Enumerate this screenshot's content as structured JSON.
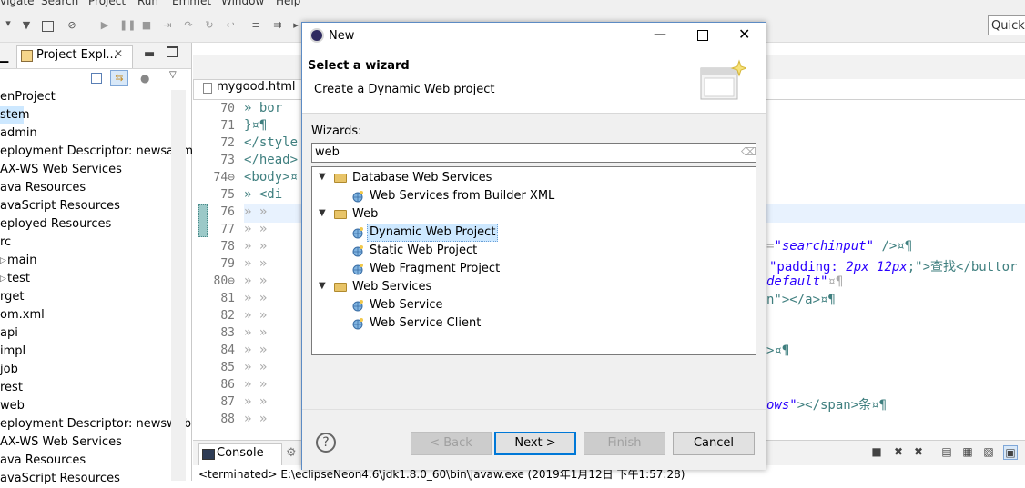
{
  "menubar": {
    "items": [
      "vigate",
      "Search",
      "Project",
      "Run",
      "Emmet",
      "Window",
      "Help"
    ]
  },
  "toolbar": {
    "quick_access_placeholder": "Quick A"
  },
  "project_explorer": {
    "tab_label": "Project Expl...",
    "items": [
      {
        "label": "enProject",
        "indent": 0
      },
      {
        "label": "stem",
        "indent": 0,
        "selected": true
      },
      {
        "label": "admin",
        "indent": 0
      },
      {
        "label": "eployment Descriptor: newsadm",
        "indent": 0
      },
      {
        "label": "AX-WS Web Services",
        "indent": 0
      },
      {
        "label": "ava Resources",
        "indent": 0
      },
      {
        "label": "avaScript Resources",
        "indent": 0
      },
      {
        "label": "eployed Resources",
        "indent": 0
      },
      {
        "label": "rc",
        "indent": 0
      },
      {
        "label": "main",
        "indent": 8
      },
      {
        "label": "test",
        "indent": 8
      },
      {
        "label": "rget",
        "indent": 0
      },
      {
        "label": "om.xml",
        "indent": 0
      },
      {
        "label": "api",
        "indent": 0
      },
      {
        "label": "impl",
        "indent": 0
      },
      {
        "label": "job",
        "indent": 0
      },
      {
        "label": "rest",
        "indent": 0
      },
      {
        "label": "web",
        "indent": 0
      },
      {
        "label": "eployment Descriptor: newsweb",
        "indent": 0
      },
      {
        "label": "AX-WS Web Services",
        "indent": 0
      },
      {
        "label": "ava Resources",
        "indent": 0
      },
      {
        "label": "avaScript Resources",
        "indent": 0
      }
    ]
  },
  "editor": {
    "tab_label": "mygood.html",
    "line_numbers": [
      "70",
      "71",
      "72",
      "73",
      "74⊖",
      "75",
      "76",
      "77",
      "78",
      "79",
      "80⊖",
      "81",
      "82",
      "83",
      "84",
      "85",
      "86",
      "87",
      "88"
    ],
    "code_left": {
      "l70": "» bor",
      "l71": "}¤¶",
      "l72": "</style",
      "l73": "</head>",
      "l74": "<body>¤",
      "l75": "» <di",
      "l76": "» »",
      "l77": "» »",
      "l78": "» »",
      "l79": "» »",
      "l80": "» »",
      "l81": "» »",
      "l82": "» »",
      "l83": "» »",
      "l84": "» »",
      "l85": "» »",
      "l86": "» »",
      "l87": "» »",
      "l88": "» »"
    },
    "code_right": {
      "r78a": "=",
      "r78b": "\"searchinput\"",
      "r78c": " />¤¶",
      "r79a": "\"padding: ",
      "r79b": "2px 12px",
      "r79c": ";\">查找</buttor",
      "r80": "default\"",
      "r80b": "¤¶",
      "r81": "n\"></a>¤¶",
      "r84": ">¤¶",
      "r87a": "ows\"",
      "r87b": "></span>条¤¶"
    }
  },
  "console": {
    "tab_label": "Console",
    "output": "<terminated> E:\\eclipseNeon4.6\\jdk1.8.0_60\\bin\\javaw.exe (2019年1月12日 下午1:57:28)"
  },
  "dialog": {
    "title": "New",
    "heading": "Select a wizard",
    "description": "Create a Dynamic Web project",
    "wizards_label": "Wizards:",
    "filter_value": "web",
    "tree": [
      {
        "label": "Database Web Services",
        "type": "folder",
        "level": 0
      },
      {
        "label": "Web Services from Builder XML",
        "type": "item",
        "level": 1
      },
      {
        "label": "Web",
        "type": "folder",
        "level": 0
      },
      {
        "label": "Dynamic Web Project",
        "type": "item",
        "level": 1,
        "selected": true
      },
      {
        "label": "Static Web Project",
        "type": "item",
        "level": 1
      },
      {
        "label": "Web Fragment Project",
        "type": "item",
        "level": 1
      },
      {
        "label": "Web Services",
        "type": "folder",
        "level": 0
      },
      {
        "label": "Web Service",
        "type": "item",
        "level": 1
      },
      {
        "label": "Web Service Client",
        "type": "item",
        "level": 1
      }
    ],
    "buttons": {
      "help": "?",
      "back": "< Back",
      "next": "Next >",
      "finish": "Finish",
      "cancel": "Cancel"
    }
  },
  "colors": {
    "accent": "#0078d7",
    "selection": "#cde8ff",
    "tag": "#3f7f7f",
    "string": "#2a00ff"
  }
}
